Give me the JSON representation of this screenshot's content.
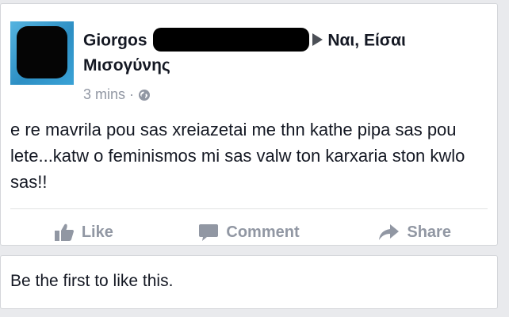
{
  "post": {
    "author_first": "Giorgos",
    "target_page": "Ναι, Είσαι",
    "target_page_line2": "Μισογύνης",
    "time": "3 mins",
    "separator": "·",
    "privacy_icon": "globe-icon",
    "body": "e re mavrila pou sas xreiazetai me thn kathe pipa sas pou lete...katw o feminismos mi sas valw ton karxaria ston kwlo sas!!"
  },
  "actions": {
    "like_label": "Like",
    "comment_label": "Comment",
    "share_label": "Share"
  },
  "likes": {
    "summary": "Be the first to like this."
  },
  "colors": {
    "background": "#e9eaed",
    "text": "#141823",
    "muted": "#9197a3",
    "avatar": "#3d9fd0"
  }
}
